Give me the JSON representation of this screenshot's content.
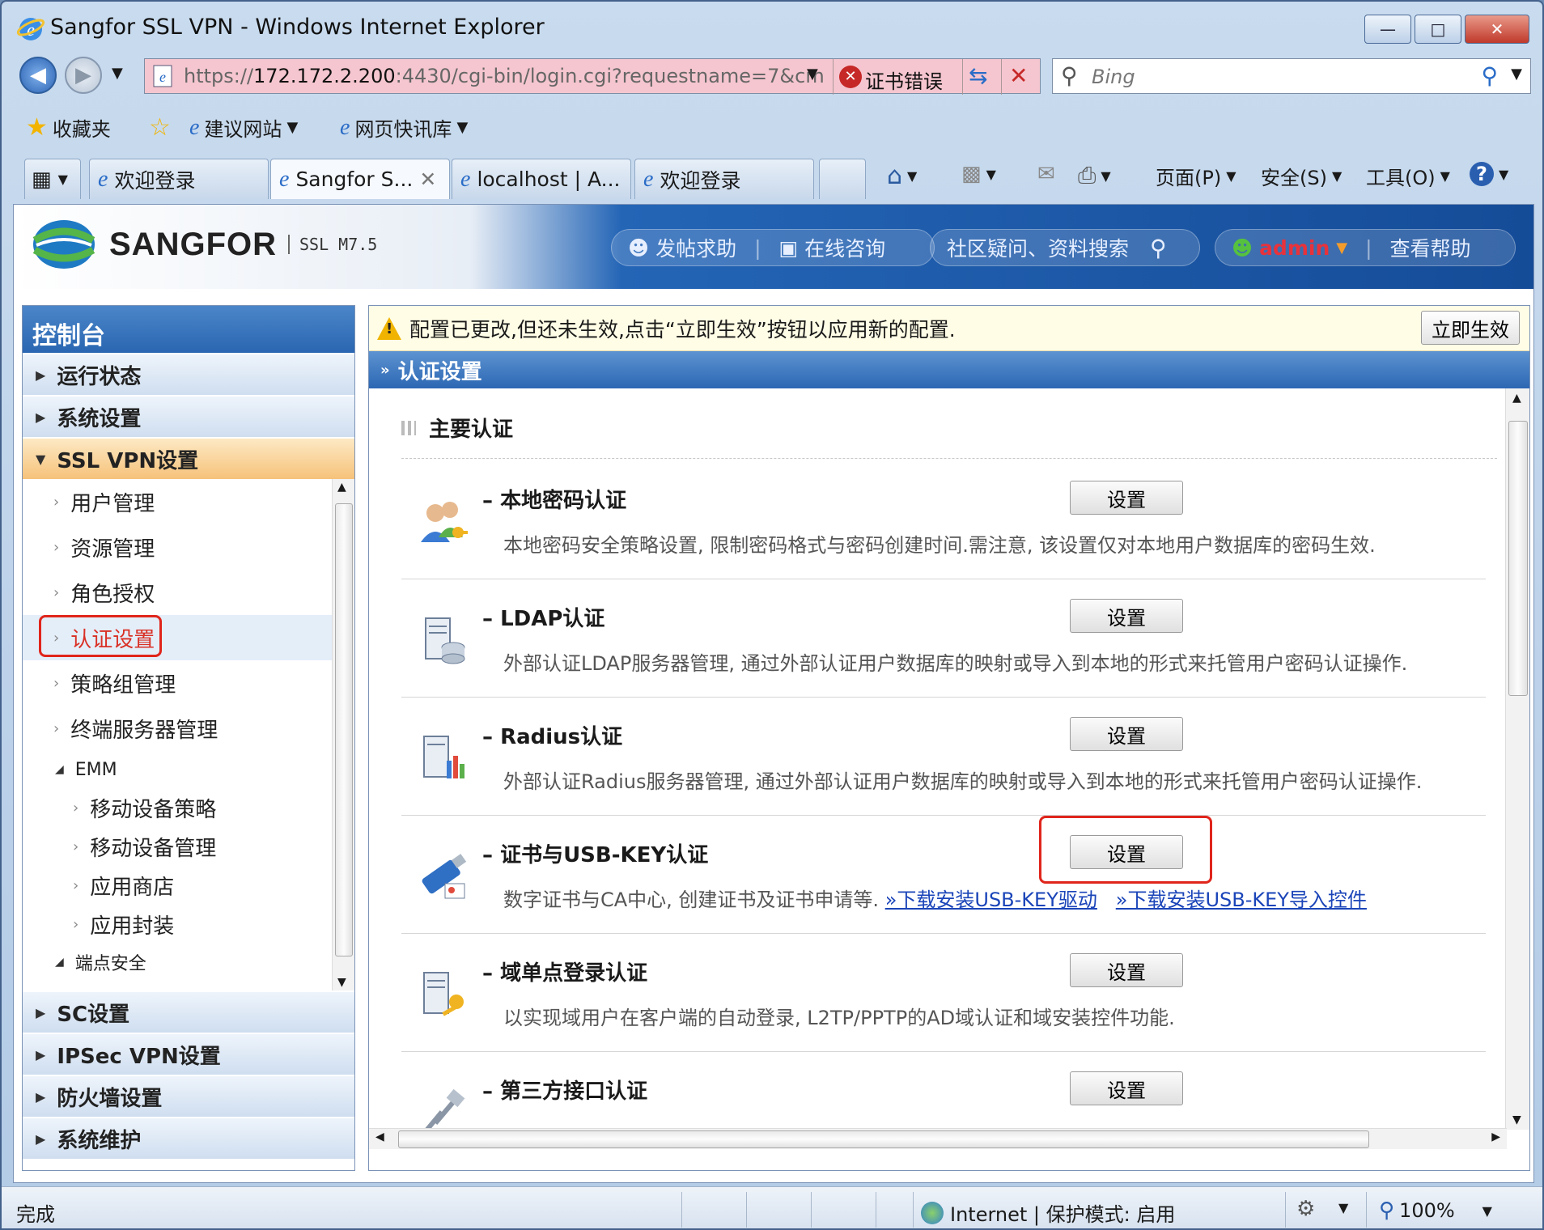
{
  "window": {
    "title": "Sangfor SSL VPN - Windows Internet Explorer",
    "controls": {
      "minimize": "—",
      "maximize": "□",
      "close": "✕"
    }
  },
  "address": {
    "url_prefix": "https://",
    "url_host": "172.172.2.200",
    "url_rest": ":4430/cgi-bin/login.cgi?requestname=7&cm",
    "cert_error": "证书错误"
  },
  "search": {
    "placeholder": "Bing"
  },
  "favorites": {
    "favorites_label": "收藏夹",
    "suggested_sites": "建议网站",
    "web_slice_gallery": "网页快讯库"
  },
  "tabs": [
    {
      "label": "欢迎登录"
    },
    {
      "label": "Sangfor S..."
    },
    {
      "label": "localhost | A..."
    },
    {
      "label": "欢迎登录"
    }
  ],
  "command_bar": {
    "page": "页面(P)",
    "safety": "安全(S)",
    "tools": "工具(O)"
  },
  "app": {
    "brand": "SANGFOR",
    "version": "SSL M7.5",
    "help_post": "发帖求助",
    "online_consult": "在线咨询",
    "community_search": "社区疑问、资料搜索",
    "user": "admin",
    "view_help": "查看帮助"
  },
  "sidebar": {
    "title": "控制台",
    "groups_top": [
      "运行状态",
      "系统设置"
    ],
    "open_group": "SSL VPN设置",
    "items": [
      "用户管理",
      "资源管理",
      "角色授权",
      "认证设置",
      "策略组管理",
      "终端服务器管理"
    ],
    "emm_header": "EMM",
    "emm_items": [
      "移动设备策略",
      "移动设备管理",
      "应用商店",
      "应用封装"
    ],
    "endpoint_header": "端点安全",
    "groups_bottom": [
      "SC设置",
      "IPSec VPN设置",
      "防火墙设置",
      "系统维护"
    ]
  },
  "notice": {
    "text": "配置已更改,但还未生效,点击“立即生效”按钮以应用新的配置.",
    "apply_button": "立即生效"
  },
  "panel": {
    "section_title": "认证设置",
    "main_title": "主要认证",
    "set_label": "设置",
    "methods": [
      {
        "name": "本地密码认证",
        "icon": "users-key-icon",
        "desc": "本地密码安全策略设置, 限制密码格式与密码创建时间.需注意, 该设置仅对本地用户数据库的密码生效."
      },
      {
        "name": "LDAP认证",
        "icon": "ldap-server-icon",
        "desc": "外部认证LDAP服务器管理, 通过外部认证用户数据库的映射或导入到本地的形式来托管用户密码认证操作."
      },
      {
        "name": "Radius认证",
        "icon": "radius-server-icon",
        "desc": "外部认证Radius服务器管理, 通过外部认证用户数据库的映射或导入到本地的形式来托管用户密码认证操作."
      },
      {
        "name": "证书与USB-KEY认证",
        "icon": "usb-key-icon",
        "desc": "数字证书与CA中心, 创建证书及证书申请等.",
        "link1": "»下载安装USB-KEY驱动",
        "link2": "»下载安装USB-KEY导入控件"
      },
      {
        "name": "域单点登录认证",
        "icon": "domain-sso-icon",
        "desc": "以实现域用户在客户端的自动登录, L2TP/PPTP的AD域认证和域安装控件功能."
      },
      {
        "name": "第三方接口认证",
        "icon": "plugin-icon",
        "desc": ""
      }
    ]
  },
  "statusbar": {
    "done": "完成",
    "zone": "Internet | 保护模式: 启用",
    "zoom": "100%"
  }
}
